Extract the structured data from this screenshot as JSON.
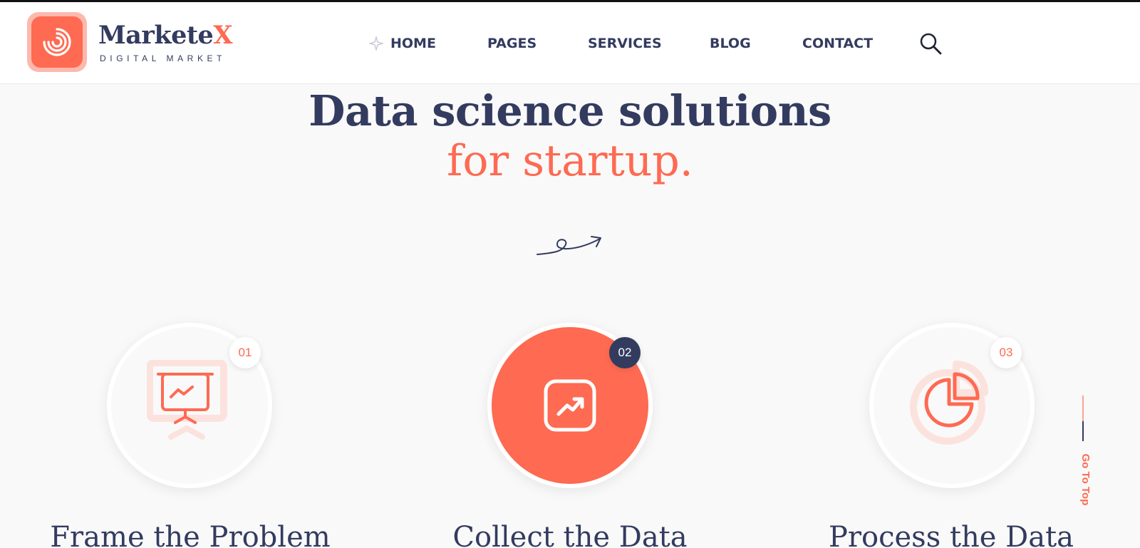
{
  "brand": {
    "name_main": "Markete",
    "name_accent": "X",
    "tagline": "DIGITAL MARKET",
    "logo_icon": "spiral-icon"
  },
  "nav": {
    "items": [
      "HOME",
      "PAGES",
      "SERVICES",
      "BLOG",
      "CONTACT"
    ],
    "search_icon": "search-icon"
  },
  "hero": {
    "title_line1": "Data science solutions",
    "title_line2": "for startup."
  },
  "steps": [
    {
      "number": "01",
      "title": "Frame the Problem",
      "icon": "presentation-chart-icon",
      "active": false
    },
    {
      "number": "02",
      "title": "Collect the Data",
      "icon": "trending-up-icon",
      "active": true
    },
    {
      "number": "03",
      "title": "Process the Data",
      "icon": "pie-chart-icon",
      "active": false
    }
  ],
  "go_to_top": "Go To Top",
  "colors": {
    "accent": "#fe6a52",
    "navy": "#333b5f",
    "background": "#f9f9f9"
  }
}
